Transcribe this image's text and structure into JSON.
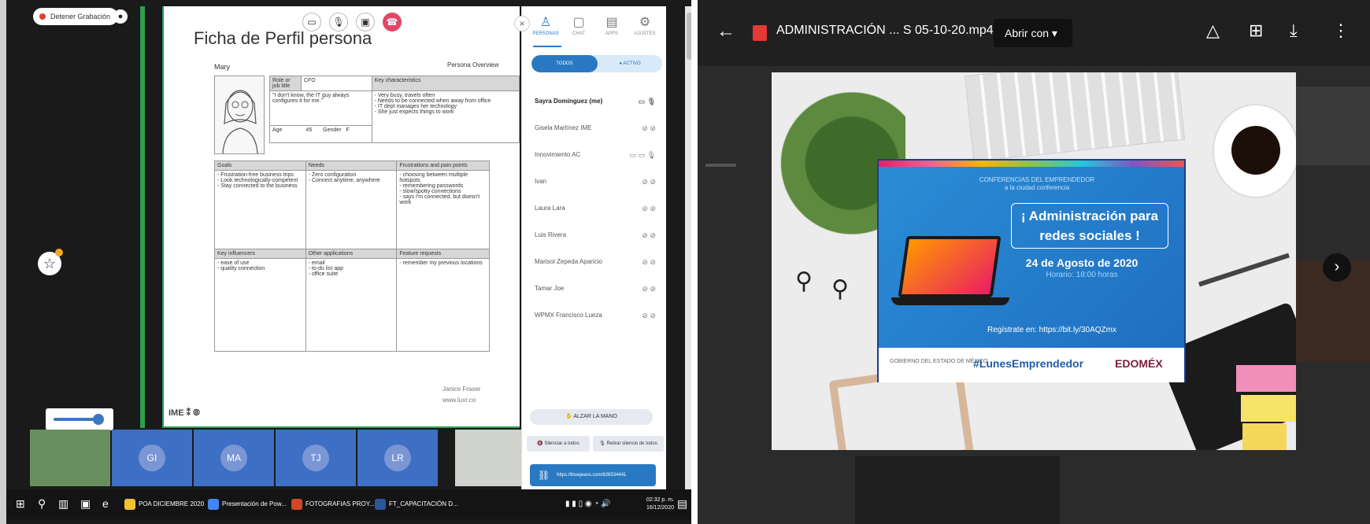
{
  "left": {
    "recording_label": "Detener Grabación",
    "slide": {
      "title": "Ficha de Perfil persona",
      "persona_name": "Mary",
      "overview_label": "Persona Overview",
      "role_header": "Role or job title",
      "role_value": "CFO",
      "key_header": "Key characteristics",
      "quote": "\"I don't know, the IT guy always configures it for me.\"",
      "key_items": "- Very busy, travels often\n- Needs to be connected when away from office\n- IT dept manages her technology\n- She just expects things to work",
      "age_label": "Age",
      "age_value": "45",
      "gender_label": "Gender",
      "gender_value": "F",
      "goals_header": "Goals",
      "goals": "- Frustration-free business trips\n- Look technologically-competent\n- Stay connected to the business",
      "needs_header": "Needs",
      "needs": "- Zero configuration\n- Connect anytime, anywhere",
      "frustrations_header": "Frustrations and pain points",
      "frustrations": "- choosing between multiple hotspots\n- remembering passwords\n- slow/spotty connections\n- says I'm connected, but doesn't work",
      "influencers_header": "Key influencers",
      "influencers": "- ease of use\n- quality connection",
      "apps_header": "Other applications",
      "apps": "- email\n- to-do list app\n- office suite",
      "features_header": "Feature requests",
      "features": "- remember my previous locations",
      "author": "Janice Fraser",
      "site": "www.luxr.co"
    },
    "panel": {
      "tabs": [
        "PERSONAS",
        "CHAT",
        "APPS",
        "AJUSTES"
      ],
      "filter_all": "TODOS",
      "filter_active": "ACTIVO",
      "participants": [
        "Sayra Dominguez (me)",
        "Gisela Martínez IME",
        "Innovimiento AC",
        "Ivan",
        "Laura Lara",
        "Luis Rivera",
        "Marisol Zepeda Aparicio",
        "Tamar Joe",
        "WPMX Francisco Lueza"
      ],
      "raise_hand": "ALZAR LA MANO",
      "silence_all": "Silenciar a todos",
      "unsilence_all": "Retirar silencio de todos",
      "meeting_link": "https://bluejeans.com/826534441"
    },
    "thumbnails": [
      "GI",
      "MA",
      "TJ",
      "LR"
    ],
    "taskbar": {
      "items": [
        "POA DICIEMBRE 2020",
        "Presentación de Pow...",
        "FOTOGRAFIAS PROY...",
        "FT_CAPACITACIÓN D..."
      ],
      "time": "02:32 p. m.",
      "date": "16/12/2020"
    }
  },
  "right": {
    "file_title": "ADMINISTRACIÓN ... S 05-10-20.mp4",
    "open_with": "Abrir con",
    "banner": {
      "small_text": "CONFERENCIAS DEL EMPRENDEDOR\na la ciudad conferencia",
      "title": "¡ Administración para redes sociales !",
      "date": "24 de Agosto de 2020",
      "hour": "Horario: 18:00 horas",
      "register": "Regístrate en: https://bit.ly/30AQZmx",
      "gov": "GOBIERNO DEL ESTADO DE MÉXICO",
      "hashtag": "#LunesEmprendedor",
      "brand": "EDOMÉX"
    }
  },
  "colors": {
    "accent_blue": "#2979c2",
    "end_call_red": "#e34766",
    "banner_blue": "#1f6fc0"
  }
}
